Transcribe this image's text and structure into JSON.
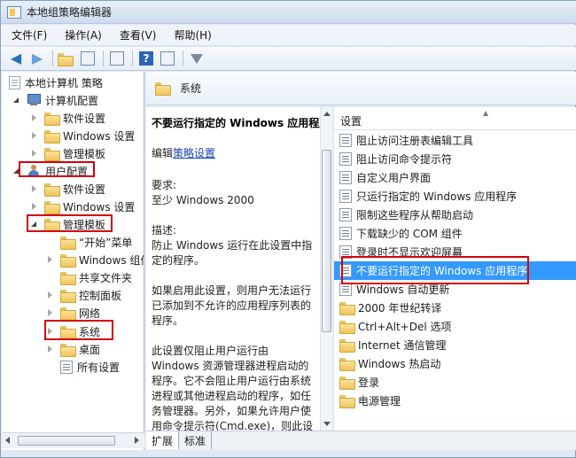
{
  "window": {
    "title": "本地组策略编辑器"
  },
  "menu": [
    "文件(F)",
    "操作(A)",
    "查看(V)",
    "帮助(H)"
  ],
  "toolbar": {
    "icons": [
      "back-arrow-icon",
      "forward-arrow-icon",
      "up-folder-icon",
      "show-tree-icon",
      "export-list-icon",
      "help-icon",
      "properties-icon",
      "filter-icon"
    ]
  },
  "tree": {
    "root": "本地计算机 策略",
    "computer_config": "计算机配置",
    "cc_software": "软件设置",
    "cc_windows": "Windows 设置",
    "cc_admin": "管理模板",
    "user_config": "用户配置",
    "uc_software": "软件设置",
    "uc_windows": "Windows 设置",
    "uc_admin": "管理模板",
    "start_menu": "“开始”菜单",
    "windows_comp": "Windows 组件",
    "shared_folders": "共享文件夹",
    "control_panel": "控制面板",
    "network": "网络",
    "system": "系统",
    "desktop": "桌面",
    "all_settings": "所有设置"
  },
  "pane": {
    "header": "系统",
    "desc_title": "不要运行指定的 Windows 应用程序",
    "edit_prefix": "编辑",
    "edit_link": "策略设置",
    "req_label": "要求:",
    "req_value": "至少 Windows 2000",
    "desc_label": "描述:",
    "desc_lines": [
      "防止 Windows 运行在此设置中指",
      "定的程序。"
    ],
    "enable_lines": [
      "如果启用此设置，则用户无法运行",
      "已添加到不允许的应用程序列表的",
      "程序。"
    ],
    "more_lines": [
      "此设置仅阻止用户运行由",
      "Windows 资源管理器进程启动的",
      "程序。它不会阻止用户运行由系统",
      "进程或其他进程启动的程序，如任",
      "务管理器。另外，如果允许用户使",
      "用命令提示符(Cmd.exe)，则此设"
    ],
    "column": "设置",
    "items": [
      {
        "label": "阻止访问注册表编辑工具",
        "icon": "setting-icon"
      },
      {
        "label": "阻止访问命令提示符",
        "icon": "setting-icon"
      },
      {
        "label": "自定义用户界面",
        "icon": "setting-icon"
      },
      {
        "label": "只运行指定的 Windows 应用程序",
        "icon": "setting-icon"
      },
      {
        "label": "限制这些程序从帮助启动",
        "icon": "setting-icon"
      },
      {
        "label": "下载缺少的 COM 组件",
        "icon": "setting-icon"
      },
      {
        "label": "登录时不显示欢迎屏幕",
        "icon": "setting-icon"
      },
      {
        "label": "不要运行指定的 Windows 应用程序",
        "icon": "setting-icon",
        "selected": true
      },
      {
        "label": "Windows 自动更新",
        "icon": "setting-icon"
      },
      {
        "label": "2000 年世纪转译",
        "icon": "folder-icon"
      },
      {
        "label": "Ctrl+Alt+Del 选项",
        "icon": "folder-icon"
      },
      {
        "label": "Internet 通信管理",
        "icon": "folder-icon"
      },
      {
        "label": "Windows 热启动",
        "icon": "folder-icon"
      },
      {
        "label": "登录",
        "icon": "folder-icon"
      },
      {
        "label": "电源管理",
        "icon": "folder-icon"
      }
    ]
  },
  "tabs": [
    "扩展",
    "标准"
  ],
  "colors": {
    "highlight": "#3399ff",
    "annotation": "#d4000f",
    "link": "#1646b3"
  }
}
